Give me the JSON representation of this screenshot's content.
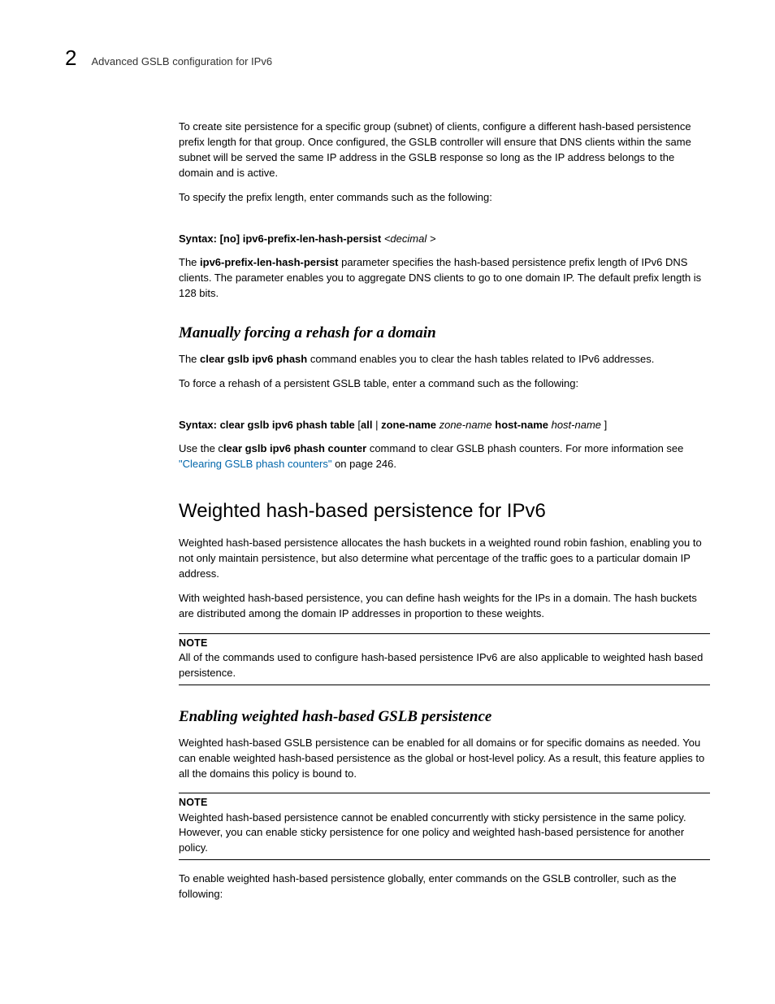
{
  "header": {
    "chapter_number": "2",
    "chapter_title": "Advanced GSLB configuration for IPv6"
  },
  "para1": "To create site persistence for a specific group (subnet) of clients, configure a different hash-based persistence prefix length for that group. Once configured, the GSLB controller will ensure that DNS clients within the same subnet will be served the same IP address in the GSLB response so long as the IP address belongs to the domain and is active.",
  "para2": "To specify the prefix length, enter commands such as the following:",
  "syntax1": {
    "label": "Syntax:",
    "bold": " [no] ipv6-prefix-len-hash-persist ",
    "italic": "<decimal >"
  },
  "para3a": "The ",
  "para3b": "ipv6-prefix-len-hash-persist",
  "para3c": " parameter specifies the hash-based persistence prefix length of IPv6 DNS clients. The parameter enables you to aggregate DNS clients to go to one domain IP. The default prefix length is 128 bits.",
  "h3a": "Manually forcing a rehash for a domain",
  "para4a": "The ",
  "para4b": "clear gslb ipv6 phash",
  "para4c": " command enables you to clear the hash tables related to IPv6 addresses.",
  "para5": "To force a rehash of a persistent GSLB table, enter a command such as the following:",
  "syntax2": {
    "label": "Syntax:",
    "b1": " clear gslb ipv6 phash table ",
    "n1": "[",
    "b2": "all",
    "n2": " | ",
    "b3": "zone-name ",
    "i1": " zone-name ",
    "b4": " host-name ",
    "i2": " host-name ",
    "n3": " ]"
  },
  "para6a": "Use the c",
  "para6b": "lear gslb ipv6 phash counter",
  "para6c": " command to clear GSLB phash counters. For more information see ",
  "para6link": "\"Clearing GSLB phash counters\"",
  "para6d": " on page 246.",
  "h2": "Weighted hash-based persistence for IPv6",
  "para7": "Weighted hash-based persistence allocates the hash buckets in a weighted round robin fashion, enabling you to not only maintain persistence, but also determine what percentage of the traffic goes to a particular domain IP address.",
  "para8": "With weighted hash-based persistence, you can define hash weights for the IPs in a domain. The hash buckets are distributed among the domain IP addresses in proportion to these weights.",
  "note1": {
    "label": "NOTE",
    "body": "All of the commands used to configure hash-based persistence IPv6 are also applicable to weighted hash based persistence."
  },
  "h3b": "Enabling weighted hash-based GSLB persistence",
  "para9": "Weighted hash-based GSLB persistence can be enabled for all domains or for specific domains as needed. You can enable weighted hash-based persistence as the global or host-level policy. As a result, this feature applies to all the domains this policy is bound to.",
  "note2": {
    "label": "NOTE",
    "body": "Weighted hash-based persistence cannot be enabled concurrently with sticky persistence in the same policy. However, you can enable sticky persistence for one policy and weighted hash-based persistence for another policy."
  },
  "para10": "To enable weighted hash-based persistence globally, enter commands on the GSLB controller, such as the following:"
}
